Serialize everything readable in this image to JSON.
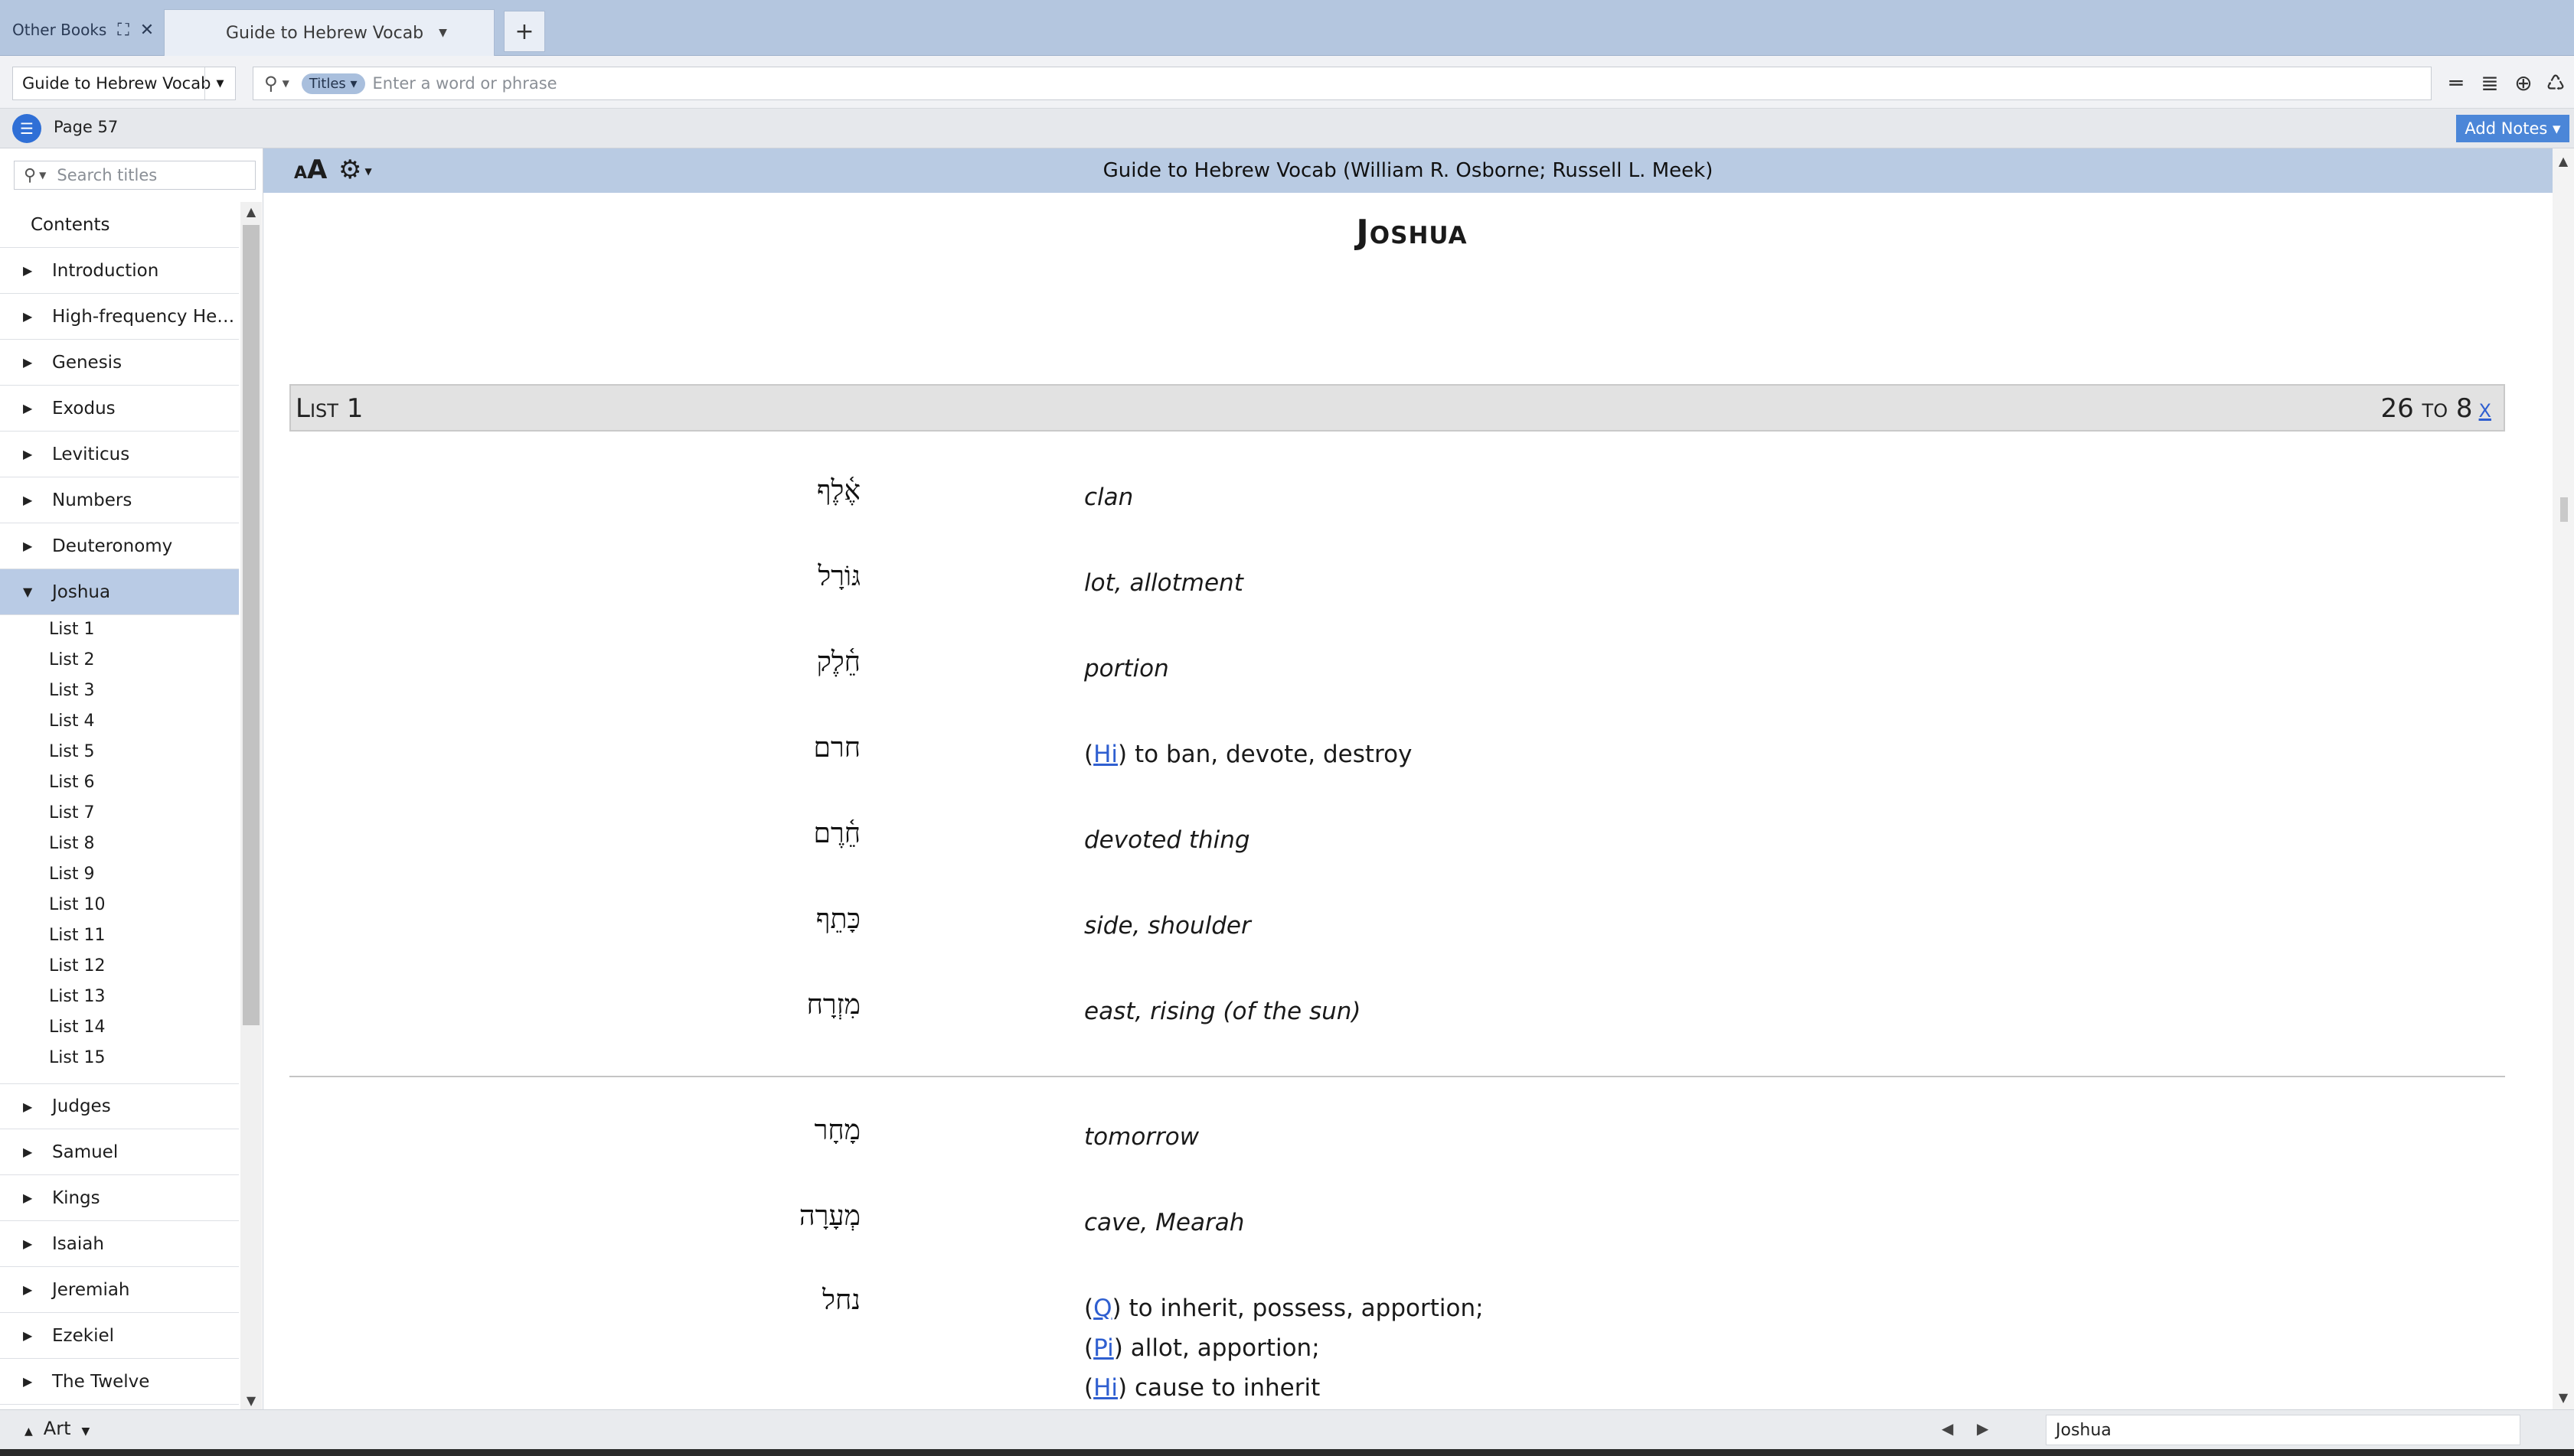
{
  "tabs": {
    "other_books": "Other Books",
    "active_tab": "Guide to Hebrew Vocab",
    "add_tab": "+"
  },
  "toolbar": {
    "book_select": "Guide to Hebrew Vocab",
    "search_scope": "Titles",
    "search_placeholder": "Enter a word or phrase"
  },
  "pagebar": {
    "page_label": "Page 57",
    "add_notes": "Add Notes"
  },
  "sidebar": {
    "search_placeholder": "Search titles",
    "contents_label": "Contents",
    "items_before": [
      "Introduction",
      "High-frequency Hebr...",
      "Genesis",
      "Exodus",
      "Leviticus",
      "Numbers",
      "Deuteronomy"
    ],
    "selected_item": "Joshua",
    "sub_items": [
      "List 1",
      "List 2",
      "List 3",
      "List 4",
      "List 5",
      "List 6",
      "List 7",
      "List 8",
      "List 9",
      "List 10",
      "List 11",
      "List 12",
      "List 13",
      "List 14",
      "List 15"
    ],
    "items_after": [
      "Judges",
      "Samuel",
      "Kings",
      "Isaiah",
      "Jeremiah",
      "Ezekiel",
      "The Twelve"
    ]
  },
  "content": {
    "font_button": "AA",
    "book_title": "Guide to Hebrew Vocab (William R. Osborne; Russell L. Meek)",
    "chapter_title": "Joshua",
    "list_title": "List 1",
    "list_range": "26 to 8",
    "list_close": "x",
    "vocab_group_1": [
      {
        "hebrew": "אֶ֫לֶף",
        "gloss": "clan"
      },
      {
        "hebrew": "גּוֹרָל",
        "gloss": "lot, allotment"
      },
      {
        "hebrew": "חֵ֫לֶק",
        "gloss": "portion"
      },
      {
        "hebrew": "חרם",
        "stem": "Hi",
        "gloss": "to ban, devote, destroy"
      },
      {
        "hebrew": "חֵ֫רֶם",
        "gloss": "devoted thing"
      },
      {
        "hebrew": "כָּתֵף",
        "gloss": "side, shoulder"
      },
      {
        "hebrew": "מִזְרָח",
        "gloss": "east, rising (of the sun)"
      }
    ],
    "vocab_group_2": [
      {
        "hebrew": "מָחָר",
        "gloss": "tomorrow"
      },
      {
        "hebrew": "מְעָרָה",
        "gloss": "cave, Mearah"
      },
      {
        "hebrew": "נחל",
        "lines": [
          {
            "stem": "Q",
            "gloss": "to inherit, possess, apportion;"
          },
          {
            "stem": "Pi",
            "gloss": "allot, apportion;"
          },
          {
            "stem": "Hi",
            "gloss": "cause to inherit"
          }
        ]
      }
    ]
  },
  "statusbar": {
    "art_label": "Art",
    "location": "Joshua"
  },
  "colors": {
    "tabstrip": "#b4c6df",
    "header_band": "#b9cbe3",
    "selected_row": "#b9cbe5",
    "accent_button": "#4b86d8",
    "link": "#2f5fd0"
  }
}
